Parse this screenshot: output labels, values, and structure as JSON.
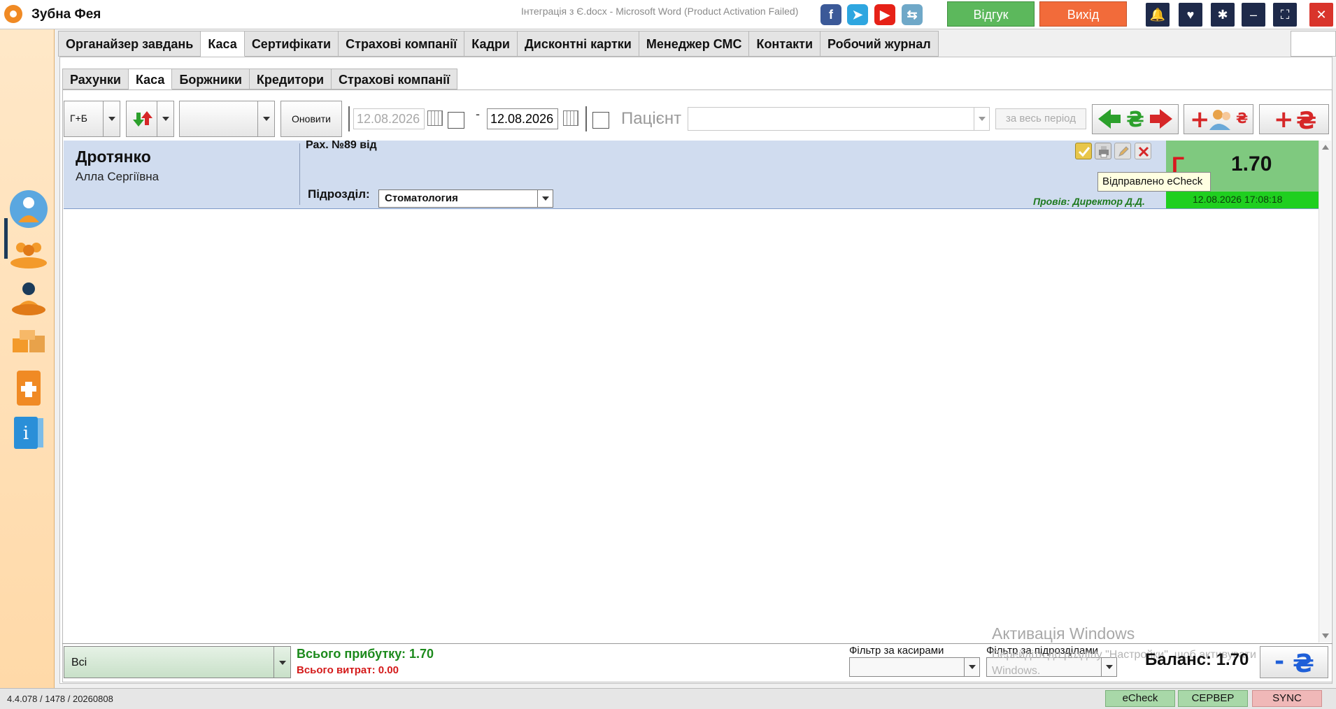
{
  "titlebar": {
    "app_title": "Зубна Фея",
    "document_title": "Інтеграція з Є.docx  -  Microsoft Word (Product Activation Failed)",
    "feedback_label": "Відгук",
    "exit_label": "Вихід"
  },
  "top_tabs": [
    {
      "label": "Органайзер завдань"
    },
    {
      "label": "Каса"
    },
    {
      "label": "Сертифікати"
    },
    {
      "label": "Страхові компанії"
    },
    {
      "label": "Кадри"
    },
    {
      "label": "Дисконтні картки"
    },
    {
      "label": "Менеджер СМС"
    },
    {
      "label": "Контакти"
    },
    {
      "label": "Робочий журнал"
    }
  ],
  "sub_tabs": [
    {
      "label": "Рахунки"
    },
    {
      "label": "Каса"
    },
    {
      "label": "Боржники"
    },
    {
      "label": "Кредитори"
    },
    {
      "label": "Страхові компанії"
    }
  ],
  "toolbar": {
    "mode_value": "Г+Б",
    "update_label": "Оновити",
    "date_from": "12.08.2026",
    "date_sep": "-",
    "date_to": "12.08.2026",
    "patient_label": "Пацієнт",
    "all_period_label": "за весь період"
  },
  "record": {
    "last_name": "Дротянко",
    "first_name": "Алла Сергіївна",
    "invoice": "Рах. №89 від",
    "department_label": "Підрозділ:",
    "department_value": "Стоматология",
    "approved_by": "Провів: Директор Д.Д.",
    "amount_mark": "Г",
    "amount": "1.70",
    "datetime": "12.08.2026 17:08:18",
    "tooltip": "Відправлено eCheck"
  },
  "footer": {
    "filter_value": "Всі",
    "income": "Всього прибутку: 1.70",
    "expense": "Всього витрат: 0.00",
    "cashier_filter_label": "Фільтр за касирами",
    "dept_filter_label": "Фільтр за підрозділами",
    "balance": "Баланс: 1.70",
    "activation_title": "Активація Windows",
    "activation_line1": "Перейдіть до розділу \"Настройки\", щоб активувати",
    "activation_line2": "Windows."
  },
  "statusbar": {
    "version": "4.4.078 / 1478 / 20260808",
    "echeck_label": "eCheck",
    "server_label": "СЕРВЕР",
    "sync_label": "SYNC"
  },
  "colors": {
    "accent_green": "#5cb85c",
    "exit_orange": "#f26b3a",
    "record_bg": "#d0dcef",
    "amount_green": "#7fc97f",
    "income_green": "#1c8a1c",
    "expense_red": "#d41a1a"
  }
}
